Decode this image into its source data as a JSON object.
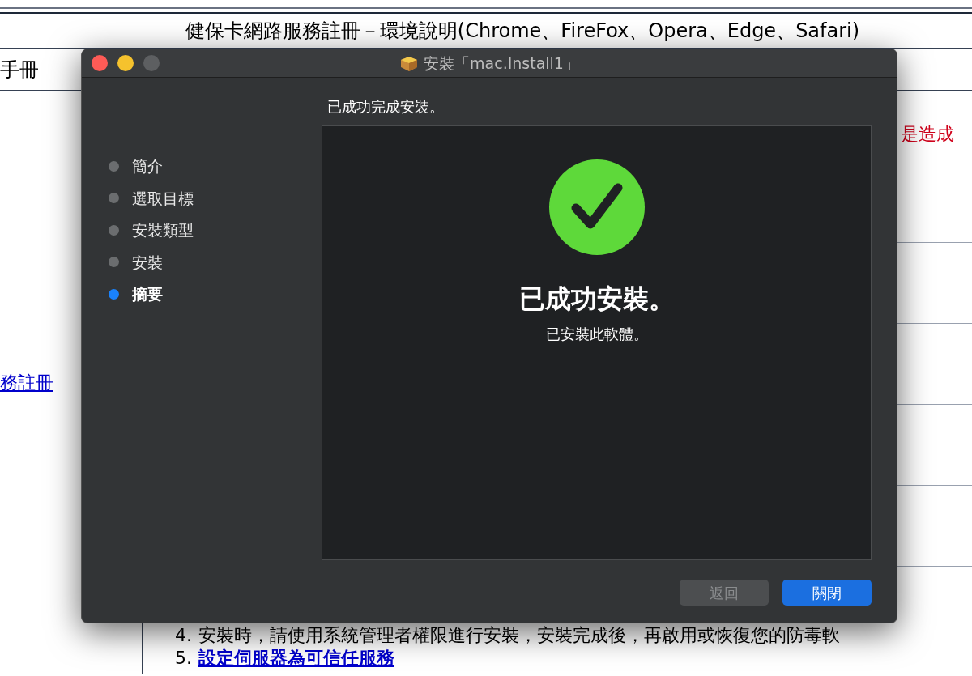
{
  "page": {
    "title": "健保卡網路服務註冊－環境說明(Chrome、FireFox、Opera、Edge、Safari)",
    "row_2_text": "手冊",
    "side_link": "務註冊",
    "red_note": "是造成",
    "steps": [
      {
        "number": "4.",
        "text": "安裝時，請使用系統管理者權限進行安裝，安裝完成後，再啟用或恢復您的防毒軟",
        "kind": "text"
      },
      {
        "number": "5.",
        "text": "設定伺服器為可信任服務",
        "kind": "link"
      }
    ]
  },
  "window": {
    "title": "安裝「mac.Install1」",
    "heading": "已成功完成安裝。",
    "steps": [
      {
        "label": "簡介",
        "selected": false
      },
      {
        "label": "選取目標",
        "selected": false
      },
      {
        "label": "安裝類型",
        "selected": false
      },
      {
        "label": "安裝",
        "selected": false
      },
      {
        "label": "摘要",
        "selected": true
      }
    ],
    "result_title": "已成功安裝。",
    "result_text": "已安裝此軟體。",
    "buttons": [
      {
        "label": "返回",
        "disabled": true,
        "kind": "secondary"
      },
      {
        "label": "關閉",
        "disabled": false,
        "kind": "primary"
      }
    ]
  }
}
